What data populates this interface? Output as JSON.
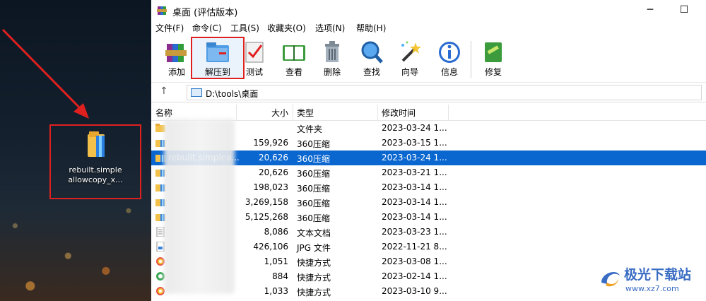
{
  "desktop": {
    "icon_label_line1": "rebuilt.simple",
    "icon_label_line2": "allowcopy_x..."
  },
  "window": {
    "title": "桌面 (评估版本)",
    "minimize": "─",
    "maximize": "☐"
  },
  "menu": [
    "文件(F)",
    "命令(C)",
    "工具(S)",
    "收藏夹(O)",
    "选项(N)",
    "帮助(H)"
  ],
  "toolbar": {
    "add": "添加",
    "extract": "解压到",
    "test": "测试",
    "view": "查看",
    "delete": "删除",
    "find": "查找",
    "wizard": "向导",
    "info": "信息",
    "repair": "修复"
  },
  "address": {
    "path": "D:\\tools\\桌面"
  },
  "columns": {
    "name": "名称",
    "size": "大小",
    "type": "类型",
    "modified": "修改时间"
  },
  "rows": [
    {
      "name": "",
      "size": "",
      "type": "文件夹",
      "date": "2023-03-24 1...",
      "icon": "folder-icon"
    },
    {
      "name": "",
      "size": "159,926",
      "type": "360压缩",
      "date": "2023-03-15 1...",
      "icon": "archive-icon"
    },
    {
      "name": "rebuilt.simplea...",
      "size": "20,626",
      "type": "360压缩",
      "date": "2023-03-24 1...",
      "icon": "archive-icon"
    },
    {
      "name": "",
      "size": "20,626",
      "type": "360压缩",
      "date": "2023-03-21 1...",
      "icon": "archive-icon"
    },
    {
      "name": "",
      "size": "198,023",
      "type": "360压缩",
      "date": "2023-03-14 1...",
      "icon": "archive-icon"
    },
    {
      "name": "",
      "size": "3,269,158",
      "type": "360压缩",
      "date": "2023-03-14 1...",
      "icon": "archive-icon"
    },
    {
      "name": "",
      "size": "5,125,268",
      "type": "360压缩",
      "date": "2023-03-14 1...",
      "icon": "archive-icon"
    },
    {
      "name": "",
      "size": "8,086",
      "type": "文本文档",
      "date": "2023-03-23 1...",
      "icon": "text-file-icon"
    },
    {
      "name": "",
      "size": "426,106",
      "type": "JPG 文件",
      "date": "2022-11-21 8...",
      "icon": "image-file-icon"
    },
    {
      "name": "",
      "size": "1,051",
      "type": "快捷方式",
      "date": "2023-03-08 1...",
      "icon": "shortcut-icon"
    },
    {
      "name": "",
      "size": "884",
      "type": "快捷方式",
      "date": "2023-02-14 1...",
      "icon": "ie-shortcut-icon"
    },
    {
      "name": "",
      "size": "1,033",
      "type": "快捷方式",
      "date": "2023-03-10 9...",
      "icon": "shortcut-icon"
    }
  ],
  "watermark": {
    "text": "极光下载站",
    "url": "www.xz7.com"
  },
  "colors": {
    "highlight": "#e0201f",
    "selection": "#0b67d0"
  }
}
